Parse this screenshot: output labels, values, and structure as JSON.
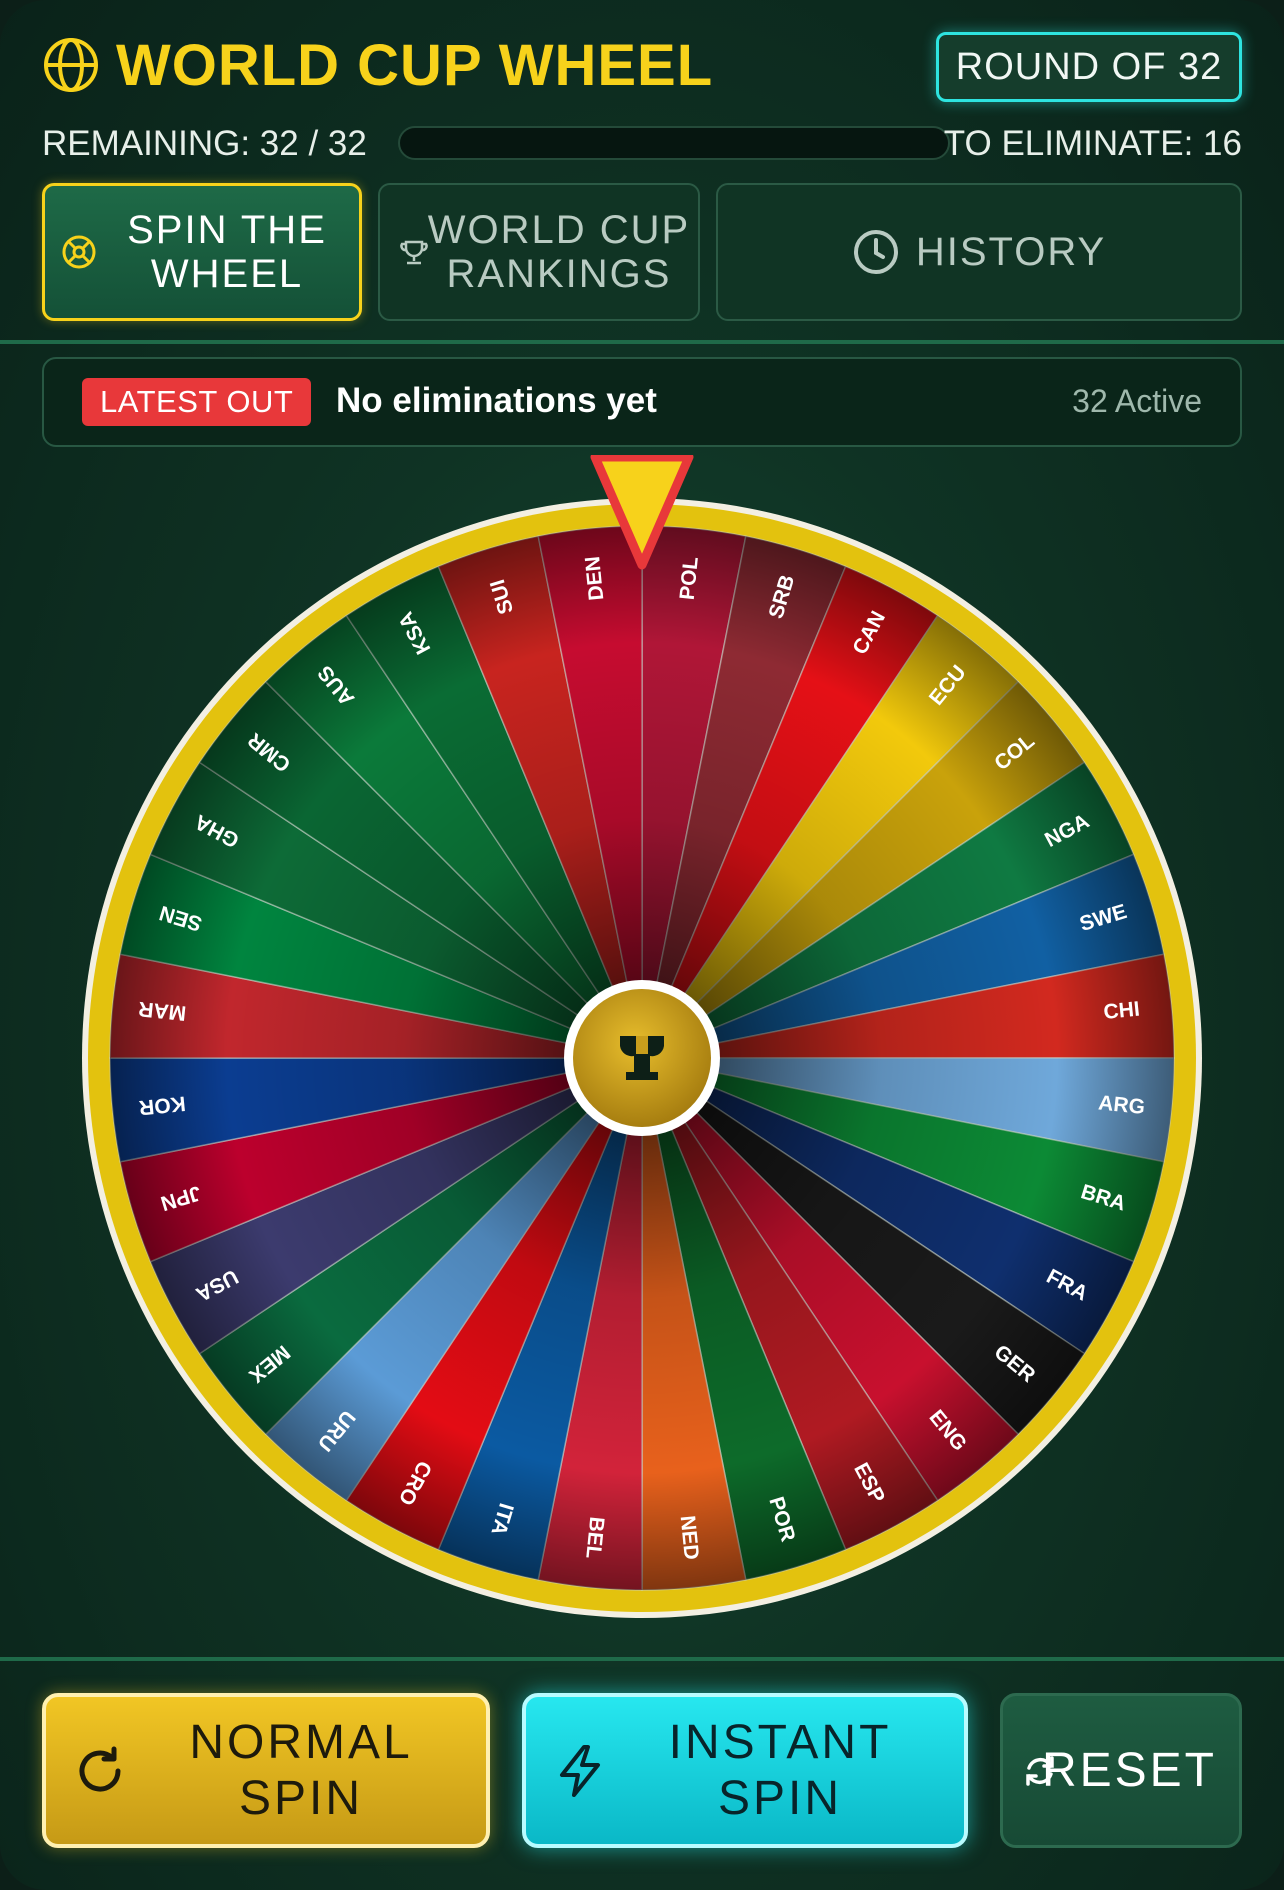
{
  "header": {
    "title": "WORLD CUP WHEEL",
    "round_label": "ROUND OF 32"
  },
  "stats": {
    "remaining_label": "REMAINING: 32 / 32",
    "eliminate_label": "TO ELIMINATE: 16",
    "progress_fraction": 0
  },
  "tabs": [
    {
      "label_line1": "SPIN THE",
      "label_line2": "WHEEL",
      "icon": "soccer-ball-icon",
      "active": true
    },
    {
      "label_line1": "WORLD CUP",
      "label_line2": "RANKINGS",
      "icon": "trophy-icon",
      "active": false
    },
    {
      "label": "HISTORY",
      "icon": "clock-icon",
      "active": false
    }
  ],
  "latest": {
    "badge": "LATEST OUT",
    "text": "No eliminations yet",
    "active_count": "32 Active"
  },
  "wheel": {
    "teams": [
      {
        "code": "POL",
        "color": "#b01637"
      },
      {
        "code": "SRB",
        "color": "#8e2a33"
      },
      {
        "code": "CAN",
        "color": "#e51016"
      },
      {
        "code": "ECU",
        "color": "#f2c90c"
      },
      {
        "code": "COL",
        "color": "#c9a20b"
      },
      {
        "code": "NGA",
        "color": "#0f7a42"
      },
      {
        "code": "SWE",
        "color": "#1160a3"
      },
      {
        "code": "CHI",
        "color": "#d2291f"
      },
      {
        "code": "ARG",
        "color": "#6fa8da"
      },
      {
        "code": "BRA",
        "color": "#0c8a35"
      },
      {
        "code": "FRA",
        "color": "#0f2f6e"
      },
      {
        "code": "GER",
        "color": "#1a1a1a"
      },
      {
        "code": "ENG",
        "color": "#c8102e"
      },
      {
        "code": "ESP",
        "color": "#b01a22"
      },
      {
        "code": "POR",
        "color": "#0d6b2a"
      },
      {
        "code": "NED",
        "color": "#e8611c"
      },
      {
        "code": "BEL",
        "color": "#d2233a"
      },
      {
        "code": "ITA",
        "color": "#0b5aa2"
      },
      {
        "code": "CRO",
        "color": "#e30c14"
      },
      {
        "code": "URU",
        "color": "#5b9bd6"
      },
      {
        "code": "MEX",
        "color": "#0a6b3f"
      },
      {
        "code": "USA",
        "color": "#3c3b6e"
      },
      {
        "code": "JPN",
        "color": "#bc002d"
      },
      {
        "code": "KOR",
        "color": "#0b3d91"
      },
      {
        "code": "MAR",
        "color": "#c1272d"
      },
      {
        "code": "SEN",
        "color": "#00853f"
      },
      {
        "code": "GHA",
        "color": "#0d6b37"
      },
      {
        "code": "CMR",
        "color": "#0a6633"
      },
      {
        "code": "AUS",
        "color": "#0b7a3a"
      },
      {
        "code": "KSA",
        "color": "#0a6c34"
      },
      {
        "code": "SUI",
        "color": "#c8241f"
      },
      {
        "code": "DEN",
        "color": "#c60c30"
      }
    ],
    "rim_color": "#e3c20e",
    "pointer_color": "#f7d21b",
    "pointer_border": "#e8383a",
    "hub_color": "#d4a61c"
  },
  "actions": {
    "normal_line1": "NORMAL",
    "normal_line2": "SPIN",
    "instant_line1": "INSTANT",
    "instant_line2": "SPIN",
    "reset": "RESET"
  }
}
